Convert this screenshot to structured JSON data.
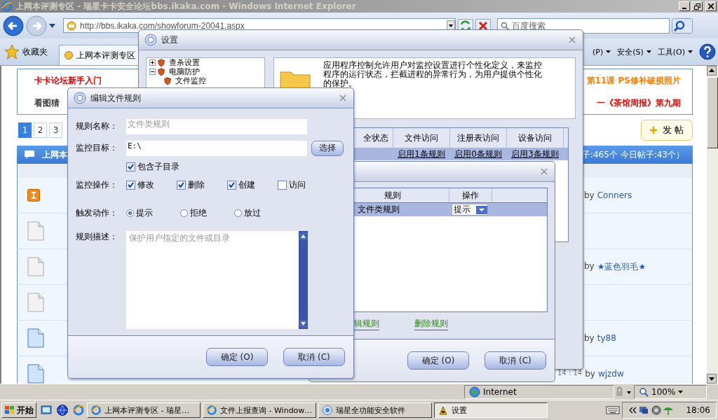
{
  "browser": {
    "title": "上网本评测专区 - 瑞星卡卡安全论坛bbs.ikaka.com - Windows Internet Explorer",
    "url": "http://bbs.ikaka.com/showforum-20041.aspx",
    "search_placeholder": "百度搜索",
    "favorites": "收藏夹",
    "tab": "上网本评测专区",
    "menus": [
      "(P)",
      "安全(S)",
      "工具(O)"
    ],
    "status_zone": "Internet",
    "zoom": "100%"
  },
  "forum": {
    "banner_left": [
      "卡卡论坛新手入门",
      "看图猜"
    ],
    "banner_right": [
      "第11课  PS修补破损照片",
      "一《茶馆周报》第九期"
    ],
    "pages": [
      {
        "label": "1",
        "selected": true
      },
      {
        "label": "2",
        "selected": false
      },
      {
        "label": "3",
        "selected": false
      }
    ],
    "post_button": "发 帖",
    "header_left": "上网本",
    "header_right": "子:465个  今日帖子:43个）",
    "rows": [
      {
        "kind": "pinned",
        "by": "by",
        "author": "Conners"
      },
      {
        "kind": "plain"
      },
      {
        "kind": "plain",
        "by": "by",
        "author": "★蓝色羽毛★"
      },
      {
        "kind": "plain"
      },
      {
        "kind": "new",
        "by": "by",
        "author": "ty88"
      },
      {
        "kind": "new",
        "time": "14 : 14",
        "by": "by",
        "author": "wjzdw"
      }
    ]
  },
  "settings": {
    "title": "设置",
    "tree": [
      {
        "label": "查杀设置",
        "expanded": false
      },
      {
        "label": "电脑防护",
        "expanded": true,
        "children": [
          {
            "label": "文件监控"
          }
        ]
      }
    ],
    "description": "应用程序控制允许用户对监控设置进行个性化定义，来监控程序的运行状态，拦截进程的异常行为，为用户提供个性化的保护。",
    "columns": [
      "全状态",
      "文件访问",
      "注册表访问",
      "设备访问"
    ],
    "row": [
      "启用1条规则",
      "启用0条规则",
      "启用3条规则"
    ]
  },
  "rules": {
    "columns": [
      "规则",
      "操作"
    ],
    "rows": [
      {
        "name": "文件类规则",
        "action": "提示",
        "selected": true
      }
    ],
    "links": [
      "辑规则",
      "删除规则"
    ],
    "buttons": [
      "确定 (O)",
      "取消 (C)"
    ]
  },
  "edit": {
    "title": "编辑文件规则",
    "name_field": {
      "label": "规则名称：",
      "value": "文件类规则",
      "disabled": true
    },
    "target_field": {
      "label": "监控目标：",
      "value": "E:\\",
      "disabled": false,
      "button": "选择"
    },
    "subdirs": {
      "label": "包含子目录",
      "checked": true
    },
    "ops_label": "监控操作：",
    "ops": [
      {
        "label": "修改",
        "checked": true
      },
      {
        "label": "删除",
        "checked": true
      },
      {
        "label": "创建",
        "checked": true
      },
      {
        "label": "访问",
        "checked": false
      }
    ],
    "action_label": "触发动作：",
    "actions": [
      {
        "label": "提示",
        "selected": true
      },
      {
        "label": "拒绝",
        "selected": false
      },
      {
        "label": "放过",
        "selected": false
      }
    ],
    "desc_field": {
      "label": "规则描述：",
      "value": "保护用户指定的文件或目录",
      "disabled": true
    },
    "buttons": [
      "确定 (O)",
      "取消 (C)"
    ]
  },
  "taskbar": {
    "start": "开始",
    "tasks": [
      {
        "label": "上网本评测专区 - 瑞星…",
        "kind": "ie",
        "selected": false
      },
      {
        "label": "文件上报查询 - Window…",
        "kind": "ie",
        "selected": false
      },
      {
        "label": "瑞星全功能安全软件",
        "kind": "app",
        "selected": false
      },
      {
        "label": "设置",
        "kind": "settings",
        "selected": true
      }
    ],
    "clock": "18:06"
  }
}
